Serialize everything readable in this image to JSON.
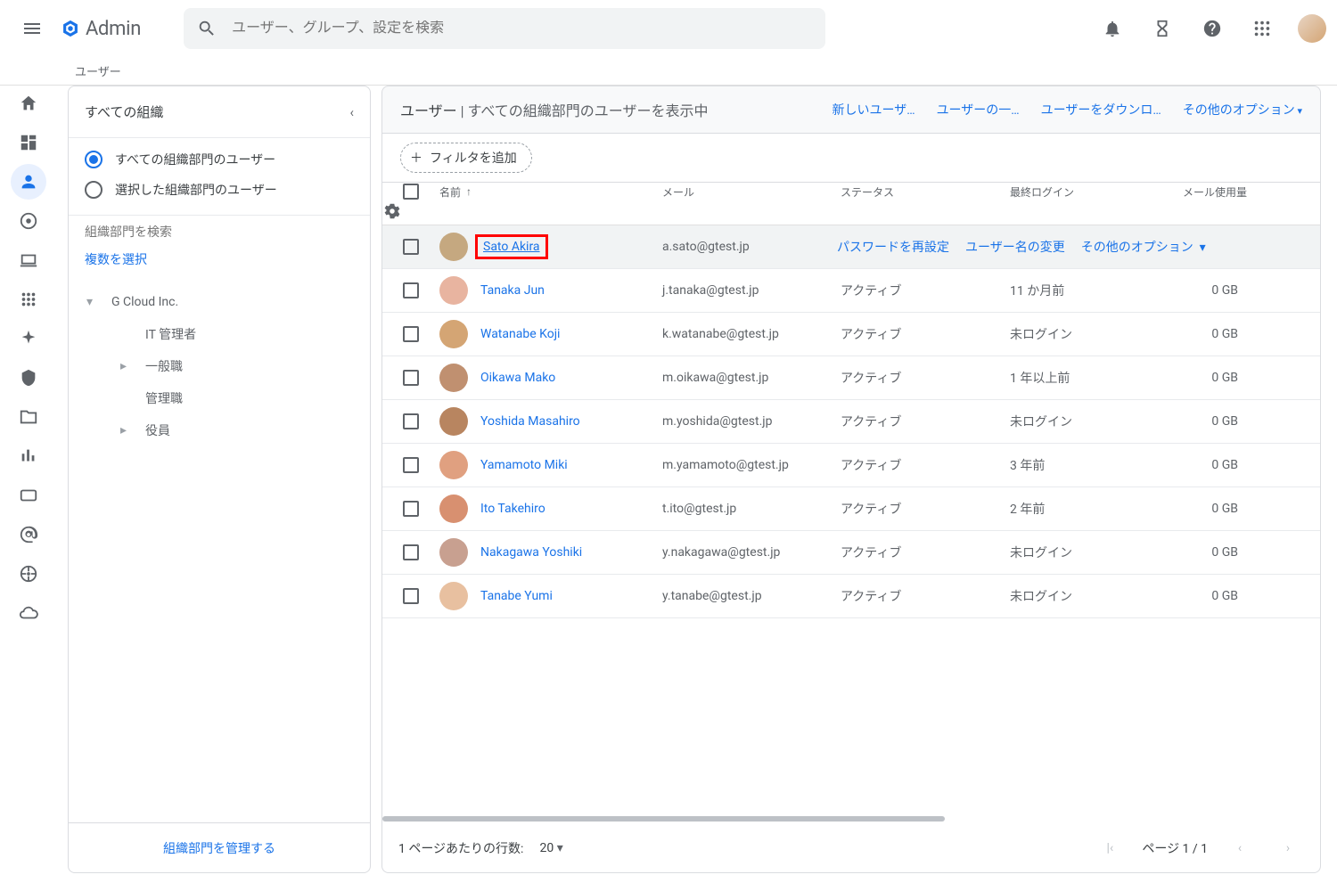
{
  "top": {
    "app_name": "Admin",
    "search_placeholder": "ユーザー、グループ、設定を検索"
  },
  "breadcrumb": "ユーザー",
  "rail": {
    "items": [
      "home",
      "dashboard",
      "users",
      "chrome",
      "devices",
      "apps",
      "sparkle",
      "security",
      "folder",
      "reports",
      "billing",
      "at",
      "wheel",
      "cloud"
    ]
  },
  "org": {
    "header": "すべての組織",
    "radio_all": "すべての組織部門のユーザー",
    "radio_selected": "選択した組織部門のユーザー",
    "search_placeholder": "組織部門を検索",
    "multi_select": "複数を選択",
    "tree": {
      "root": "G Cloud Inc.",
      "children": [
        "IT 管理者",
        "一般職",
        "管理職",
        "役員"
      ]
    },
    "footer": "組織部門を管理する"
  },
  "panel": {
    "title": "ユーザー",
    "subtitle": " | すべての組織部門のユーザーを表示中",
    "actions": [
      "新しいユーザ…",
      "ユーザーの一…",
      "ユーザーをダウンロ…",
      "その他のオプション"
    ],
    "filter_label": "フィルタを追加"
  },
  "columns": {
    "name": "名前",
    "email": "メール",
    "status": "ステータス",
    "last_login": "最終ログイン",
    "mail_usage": "メール使用量"
  },
  "row_actions": {
    "reset_pw": "パスワードを再設定",
    "rename": "ユーザー名の変更",
    "more": "その他のオプション"
  },
  "users": [
    {
      "name": "Sato Akira",
      "email": "a.sato@gtest.jp",
      "status": "",
      "login": "",
      "usage": "",
      "hover": true,
      "highlight": true
    },
    {
      "name": "Tanaka Jun",
      "email": "j.tanaka@gtest.jp",
      "status": "アクティブ",
      "login": "11 か月前",
      "usage": "0 GB"
    },
    {
      "name": "Watanabe Koji",
      "email": "k.watanabe@gtest.jp",
      "status": "アクティブ",
      "login": "未ログイン",
      "usage": "0 GB"
    },
    {
      "name": "Oikawa Mako",
      "email": "m.oikawa@gtest.jp",
      "status": "アクティブ",
      "login": "1 年以上前",
      "usage": "0 GB"
    },
    {
      "name": "Yoshida Masahiro",
      "email": "m.yoshida@gtest.jp",
      "status": "アクティブ",
      "login": "未ログイン",
      "usage": "0 GB"
    },
    {
      "name": "Yamamoto Miki",
      "email": "m.yamamoto@gtest.jp",
      "status": "アクティブ",
      "login": "3 年前",
      "usage": "0 GB"
    },
    {
      "name": "Ito Takehiro",
      "email": "t.ito@gtest.jp",
      "status": "アクティブ",
      "login": "2 年前",
      "usage": "0 GB"
    },
    {
      "name": "Nakagawa Yoshiki",
      "email": "y.nakagawa@gtest.jp",
      "status": "アクティブ",
      "login": "未ログイン",
      "usage": "0 GB"
    },
    {
      "name": "Tanabe Yumi",
      "email": "y.tanabe@gtest.jp",
      "status": "アクティブ",
      "login": "未ログイン",
      "usage": "0 GB"
    }
  ],
  "pagination": {
    "rows_label": "1 ページあたりの行数:",
    "rows_value": "20",
    "page_label": "ページ 1 / 1"
  }
}
